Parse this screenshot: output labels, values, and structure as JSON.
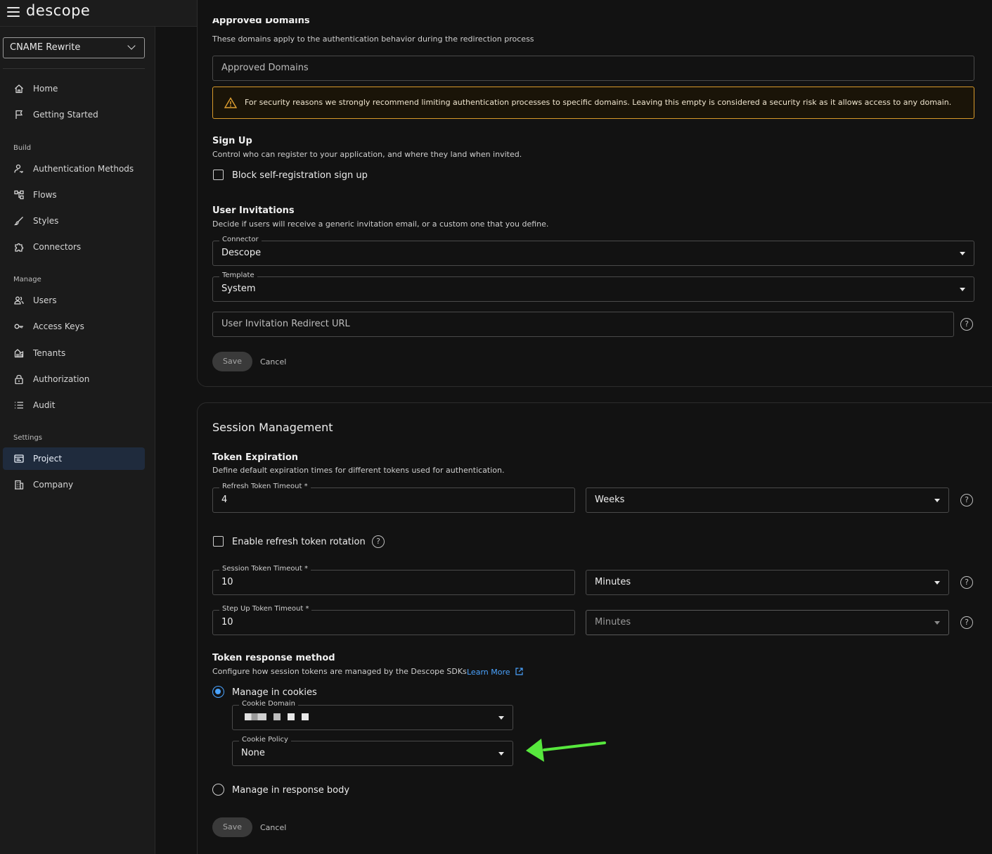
{
  "app": {
    "logo": "descope"
  },
  "sidebar": {
    "project": "CNAME Rewrite",
    "items_top": [
      {
        "label": "Home",
        "icon": "home-icon"
      },
      {
        "label": "Getting Started",
        "icon": "flag-icon"
      }
    ],
    "build_label": "Build",
    "items_build": [
      {
        "label": "Authentication Methods",
        "icon": "user-key-icon"
      },
      {
        "label": "Flows",
        "icon": "flow-icon"
      },
      {
        "label": "Styles",
        "icon": "brush-icon"
      },
      {
        "label": "Connectors",
        "icon": "puzzle-icon"
      }
    ],
    "manage_label": "Manage",
    "items_manage": [
      {
        "label": "Users",
        "icon": "users-icon"
      },
      {
        "label": "Access Keys",
        "icon": "key-icon"
      },
      {
        "label": "Tenants",
        "icon": "tenants-icon"
      },
      {
        "label": "Authorization",
        "icon": "lock-icon"
      },
      {
        "label": "Audit",
        "icon": "list-icon"
      }
    ],
    "settings_label": "Settings",
    "items_settings": [
      {
        "label": "Project",
        "icon": "project-icon",
        "active": true
      },
      {
        "label": "Company",
        "icon": "building-icon"
      }
    ]
  },
  "approved": {
    "title": "Approved Domains",
    "desc": "These domains apply to the authentication behavior during the redirection process",
    "placeholder": "Approved Domains",
    "warning": "For security reasons we strongly recommend limiting authentication processes to specific domains. Leaving this empty is considered a security risk as it allows access to any domain."
  },
  "signup": {
    "title": "Sign Up",
    "desc": "Control who can register to your application, and where they land when invited.",
    "checkbox": "Block self-registration sign up"
  },
  "invites": {
    "title": "User Invitations",
    "desc": "Decide if users will receive a generic invitation email, or a custom one that you define.",
    "connector_label": "Connector",
    "connector_value": "Descope",
    "template_label": "Template",
    "template_value": "System",
    "redirect_placeholder": "User Invitation Redirect URL",
    "save": "Save",
    "cancel": "Cancel"
  },
  "session": {
    "title": "Session Management",
    "token_title": "Token Expiration",
    "token_desc": "Define default expiration times for different tokens used for authentication.",
    "refresh_label": "Refresh Token Timeout *",
    "refresh_value": "4",
    "refresh_unit": "Weeks",
    "rotation_label": "Enable refresh token rotation",
    "session_label": "Session Token Timeout *",
    "session_value": "10",
    "session_unit": "Minutes",
    "stepup_label": "Step Up Token Timeout *",
    "stepup_value": "10",
    "stepup_unit": "Minutes",
    "response_title": "Token response method",
    "response_desc": "Configure how session tokens are managed by the Descope SDKs",
    "learn_more": "Learn More",
    "cookies_option": "Manage in cookies",
    "cookie_domain_label": "Cookie Domain",
    "cookie_policy_label": "Cookie Policy",
    "cookie_policy_value": "None",
    "body_option": "Manage in response body",
    "save": "Save",
    "cancel": "Cancel"
  },
  "colors": {
    "accent": "#4aa3ff",
    "warning": "#d89a2a",
    "annotation_arrow": "#57e83d"
  }
}
